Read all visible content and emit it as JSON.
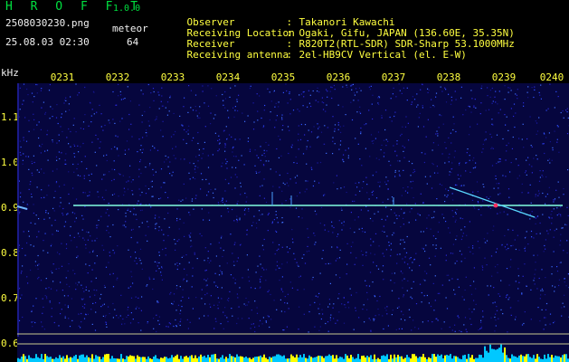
{
  "header": {
    "app_title": "H R O F F T",
    "app_version": "1.0.0",
    "file_name": "2508030230.png",
    "timestamp": "25.08.03 02:30",
    "meteor_label": "meteor",
    "meteor_count": "64",
    "info": [
      {
        "label": "Observer",
        "value": "Takanori Kawachi"
      },
      {
        "label": "Receiving Location",
        "value": "Ogaki, Gifu, JAPAN (136.60E, 35.35N)"
      },
      {
        "label": "Receiver",
        "value": "R820T2(RTL-SDR) SDR-Sharp 53.1000MHz"
      },
      {
        "label": "Receiving antenna",
        "value": "2el-HB9CV Vertical (el. E-W)"
      }
    ]
  },
  "axes": {
    "unit": "kHz",
    "time_ticks": [
      "0231",
      "0232",
      "0233",
      "0234",
      "0235",
      "0236",
      "0237",
      "0238",
      "0239",
      "0240"
    ],
    "y_ticks": [
      "1.1",
      "1.0",
      "0.9",
      "0.8",
      "0.7",
      "0.6"
    ]
  },
  "colors": {
    "background": "#000000",
    "text_green": "#00e040",
    "text_yellow": "#ffff40",
    "noise_floor": "#0a0a6a",
    "carrier": "#80ffe0",
    "histogram": "#00c8ff",
    "histogram_peak": "#ffff00"
  }
}
